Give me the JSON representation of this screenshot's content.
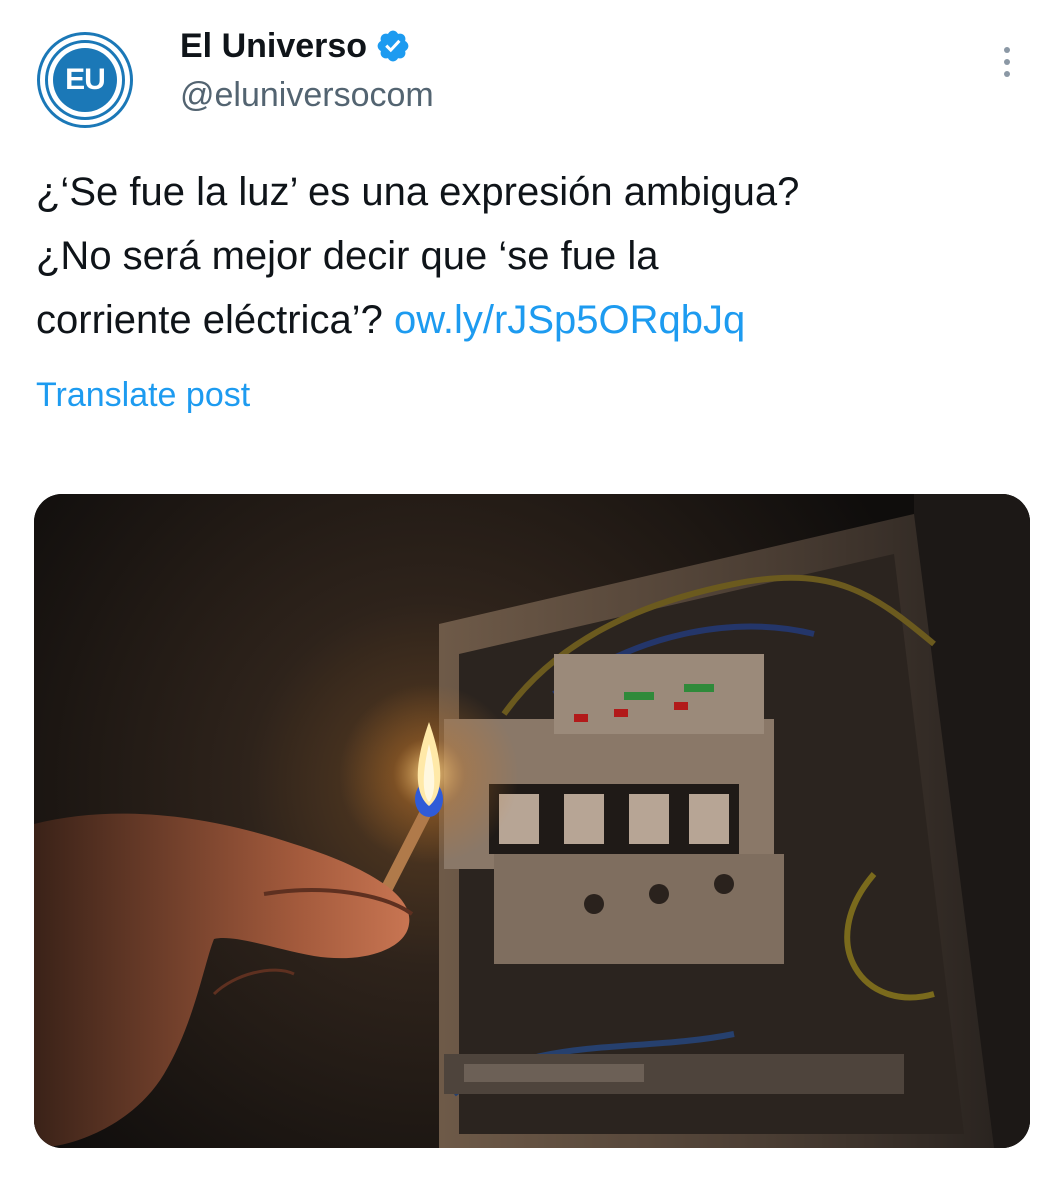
{
  "tweet": {
    "author": {
      "display_name": "El Universo",
      "handle": "@eluniversocom",
      "avatar_text": "EU",
      "verified": true
    },
    "text_lines": [
      "¿‘Se fue la luz’ es una expresión ambigua?",
      "¿No será mejor decir que ‘se fue la",
      "corriente eléctrica’?"
    ],
    "link_text": "ow.ly/rJSp5ORqbJq",
    "translate_label": "Translate post",
    "media": {
      "icon": "photo-icon"
    }
  },
  "colors": {
    "accent": "#1d9bf0",
    "text": "#0f1419",
    "secondary_text": "#536471",
    "verified_badge": "#1d9bf0",
    "avatar_blue": "#1b78b7"
  }
}
